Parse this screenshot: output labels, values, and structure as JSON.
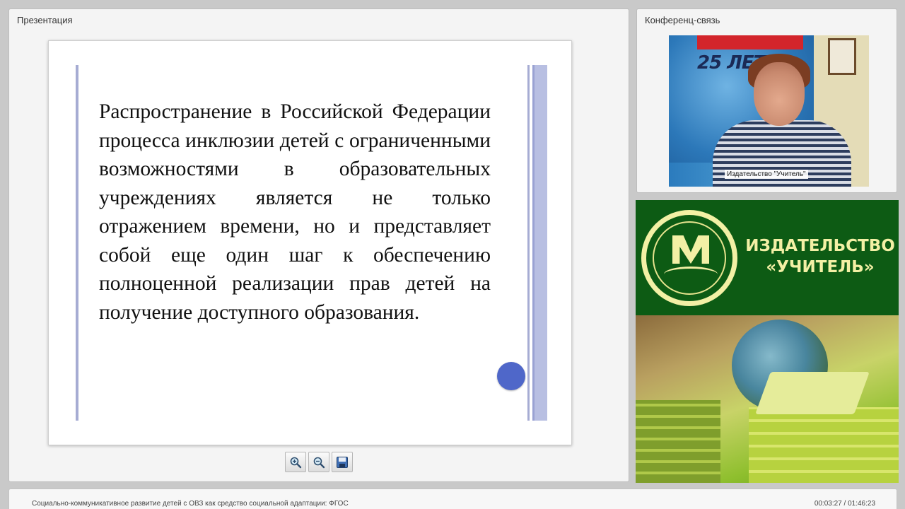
{
  "presentation": {
    "title": "Презентация",
    "slide_text": "Распространение в Российской Федерации процесса инклюзии детей с ограниченными возможностями в образовательных учреждениях является не только отражением времени, но и представляет собой еще один шаг к обеспечению полноценной реализации прав детей на получение доступного образования.",
    "toolbar": [
      {
        "name": "zoom-in-button",
        "icon": "zoom-in-icon"
      },
      {
        "name": "zoom-out-button",
        "icon": "zoom-out-icon"
      },
      {
        "name": "save-button",
        "icon": "save-icon"
      }
    ]
  },
  "conference": {
    "title": "Конференц-связь",
    "video_caption": "Издательство \"Учитель\"",
    "banner_number": "25 ЛЕТ"
  },
  "publisher": {
    "line1": "ИЗДАТЕЛЬСТВО",
    "line2": "«УЧИТЕЛЬ»"
  },
  "footer": {
    "course_title": "Социально-коммуникативное развитие детей с ОВЗ как средство социальной адаптации: ФГОС",
    "time": "00:03:27 / 01:46:23"
  },
  "colors": {
    "slide_accent": "#a6acd3",
    "slide_dot": "#4f67c9",
    "publisher_green": "#0d5b14",
    "publisher_text": "#f3f0a5"
  }
}
